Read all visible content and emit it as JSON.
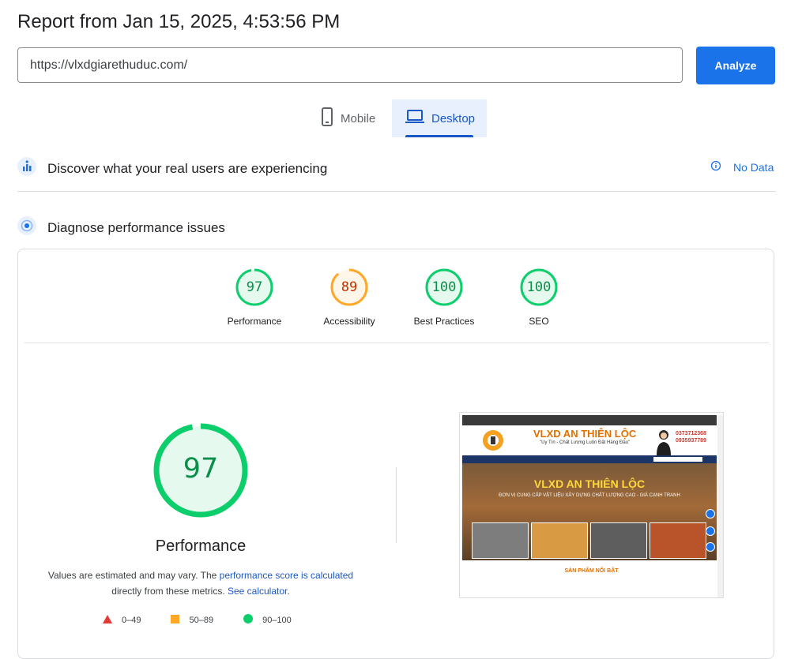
{
  "report_title": "Report from Jan 15, 2025, 4:53:56 PM",
  "url_input": {
    "value": "https://vlxdgiarethuduc.com/"
  },
  "analyze_label": "Analyze",
  "tabs": {
    "mobile": "Mobile",
    "desktop": "Desktop",
    "selected": "Desktop"
  },
  "discover": {
    "text": "Discover what your real users are experiencing",
    "status": "No Data"
  },
  "diagnose": {
    "text": "Diagnose performance issues"
  },
  "scores": [
    {
      "label": "Performance",
      "value": "97",
      "rating": "good"
    },
    {
      "label": "Accessibility",
      "value": "89",
      "rating": "average"
    },
    {
      "label": "Best Practices",
      "value": "100",
      "rating": "good"
    },
    {
      "label": "SEO",
      "value": "100",
      "rating": "good"
    }
  ],
  "main_score": {
    "value": "97",
    "label": "Performance"
  },
  "description": {
    "prefix": "Values are estimated and may vary. The ",
    "link1": "performance score is calculated",
    "middle": " directly from these metrics. ",
    "link2": "See calculator",
    "suffix": "."
  },
  "legend": [
    {
      "range": "0–49",
      "shape": "triangle",
      "color": "#e53935"
    },
    {
      "range": "50–89",
      "shape": "square",
      "color": "#ffa726"
    },
    {
      "range": "90–100",
      "shape": "circle",
      "color": "#0cce6b"
    }
  ],
  "colors": {
    "good": "#0cce6b",
    "good_text": "#0a8f4a",
    "average": "#ffa726",
    "average_text": "#c33300",
    "accent": "#1a73e8"
  },
  "screenshot": {
    "brand": "VLXD AN THIÊN LỘC",
    "slogan": "\"Uy Tín - Chất Lượng Luôn Đặt Hàng Đầu\"",
    "phone1": "0373712368",
    "phone2": "0935937789",
    "hero_title": "VLXD AN THIÊN LỘC",
    "hero_subtitle": "ĐƠN VỊ CUNG CẤP VẬT LIỆU XÂY DỰNG CHẤT LƯỢNG CAO - GIÁ CẠNH TRANH",
    "section_title": "SẢN PHẨM NỔI BẬT"
  }
}
